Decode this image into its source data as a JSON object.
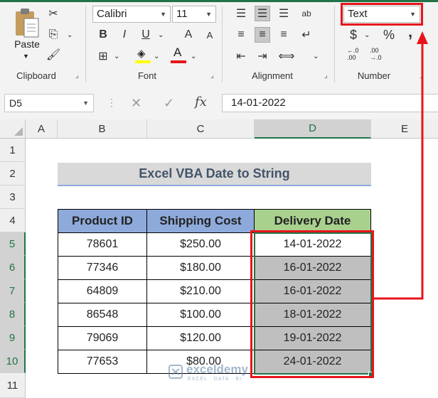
{
  "ribbon": {
    "clipboard": {
      "paste_label": "Paste",
      "group_label": "Clipboard"
    },
    "font": {
      "font_name": "Calibri",
      "font_size": "11",
      "group_label": "Font",
      "bold": "B",
      "italic": "I",
      "underline": "U",
      "grow": "A",
      "shrink": "A",
      "font_color_glyph": "A"
    },
    "alignment": {
      "group_label": "Alignment",
      "orientation": "ab"
    },
    "number": {
      "format": "Text",
      "group_label": "Number",
      "currency": "$",
      "percent": "%",
      "comma": ",",
      "inc_decimal": "←.0\n.00",
      "dec_decimal": ".00\n→.0"
    }
  },
  "formula_bar": {
    "name_box": "D5",
    "cancel": "✕",
    "enter": "✓",
    "fx": "fx",
    "value": "14-01-2022"
  },
  "columns": [
    "A",
    "B",
    "C",
    "D",
    "E"
  ],
  "rows": [
    "1",
    "2",
    "3",
    "4",
    "5",
    "6",
    "7",
    "8",
    "9",
    "10",
    "11"
  ],
  "sheet": {
    "title": "Excel VBA Date to String",
    "headers": [
      "Product ID",
      "Shipping Cost",
      "Delivery Date"
    ],
    "data": [
      [
        "78601",
        "$250.00",
        "14-01-2022"
      ],
      [
        "77346",
        "$180.00",
        "16-01-2022"
      ],
      [
        "64809",
        "$210.00",
        "16-01-2022"
      ],
      [
        "86548",
        "$100.00",
        "18-01-2022"
      ],
      [
        "79069",
        "$120.00",
        "19-01-2022"
      ],
      [
        "77653",
        "$80.00",
        "24-01-2022"
      ]
    ]
  },
  "watermark": {
    "name": "exceldemy",
    "tagline": "EXCEL · DATA · BI"
  },
  "colors": {
    "header_blue": "#8eaadb",
    "header_green": "#a9d18e",
    "title_bg": "#d9d9d9",
    "selected_gray": "#bfbfbf",
    "annotation_red": "#e8141b",
    "excel_green": "#217346"
  }
}
